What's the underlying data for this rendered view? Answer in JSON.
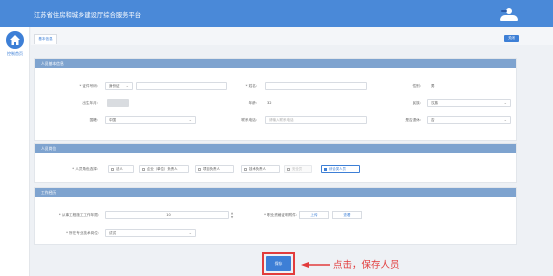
{
  "header": {
    "app_title": "江苏省住房和城乡建设厅综合服务平台"
  },
  "nav": {
    "home_label": "控制首页",
    "icon": "home-icon"
  },
  "tabs": {
    "active_label": "基本信息",
    "close_label": "关闭"
  },
  "person_info": {
    "title": "人员基本信息",
    "id_type_label": "* 证件号码:",
    "id_type_value": "身份证",
    "name_label": "* 姓名:",
    "gender_label": "性别:",
    "gender_value": "男",
    "birth_label": "出生年月:",
    "age_label": "年龄:",
    "age_value": "32",
    "ethnicity_label": "民族:",
    "ethnicity_value": "汉族",
    "nationality_label": "国籍:",
    "nationality_value": "中国",
    "contact_label": "联系电话:",
    "contact_placeholder": "请输入联系电话",
    "retired_label": "是否退休:",
    "retired_value": "否"
  },
  "role_info": {
    "title": "人员岗位",
    "role_label": "* 人员角色选择:",
    "options": [
      "法人",
      "企业（单位）负责人",
      "项目负责人",
      "技术负责人",
      "安全员",
      "综合类人员"
    ]
  },
  "work_info": {
    "title": "工作经历",
    "years_label": "* 从事工程施工工作年限:",
    "years_value": "10",
    "proof_label": "* 职业资格证明附件:",
    "upload_label": "上传",
    "view_label": "查看",
    "position_label": "* 所在专业技术岗位:",
    "position_value": "试试"
  },
  "footer": {
    "save_label": "保存",
    "annotation": "点击，保存人员",
    "annotation_color": "#e23c3c"
  }
}
